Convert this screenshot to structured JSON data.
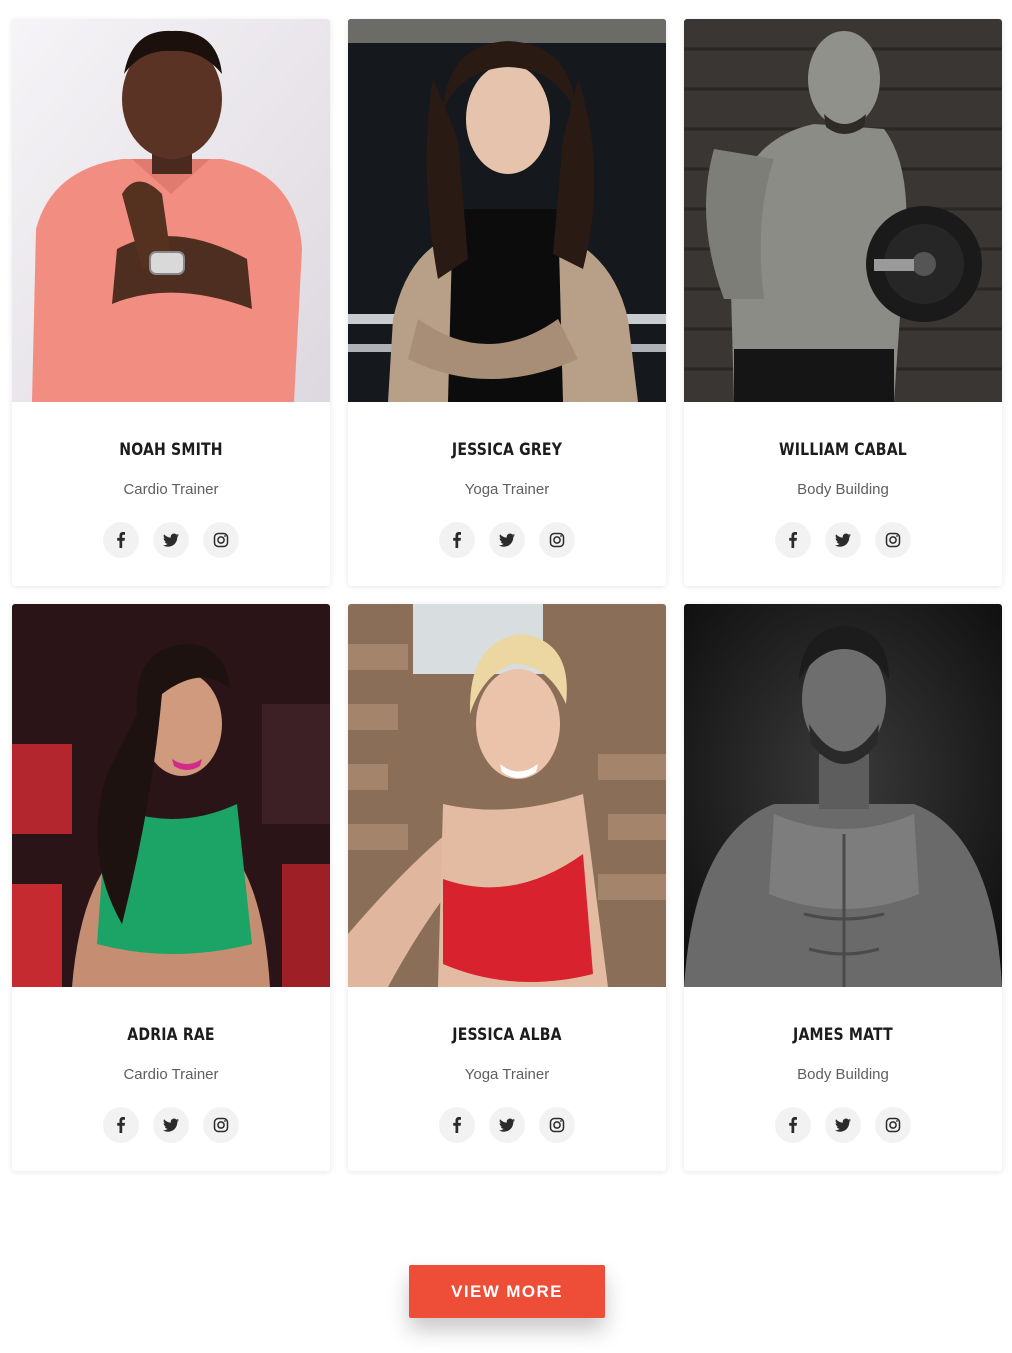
{
  "trainers": [
    {
      "name": "NOAH SMITH",
      "role": "Cardio Trainer"
    },
    {
      "name": "JESSICA GREY",
      "role": "Yoga Trainer"
    },
    {
      "name": "WILLIAM CABAL",
      "role": "Body Building"
    },
    {
      "name": "ADRIA RAE",
      "role": "Cardio Trainer"
    },
    {
      "name": "JESSICA ALBA",
      "role": "Yoga Trainer"
    },
    {
      "name": "JAMES MATT",
      "role": "Body Building"
    }
  ],
  "social_icons": [
    "facebook-icon",
    "twitter-icon",
    "instagram-icon"
  ],
  "view_more_label": "VIEW MORE",
  "colors": {
    "accent": "#ee4e37",
    "name_text": "#1c1c1c",
    "role_text": "#5f5f5f",
    "icon_bg": "#f2f2f2"
  }
}
